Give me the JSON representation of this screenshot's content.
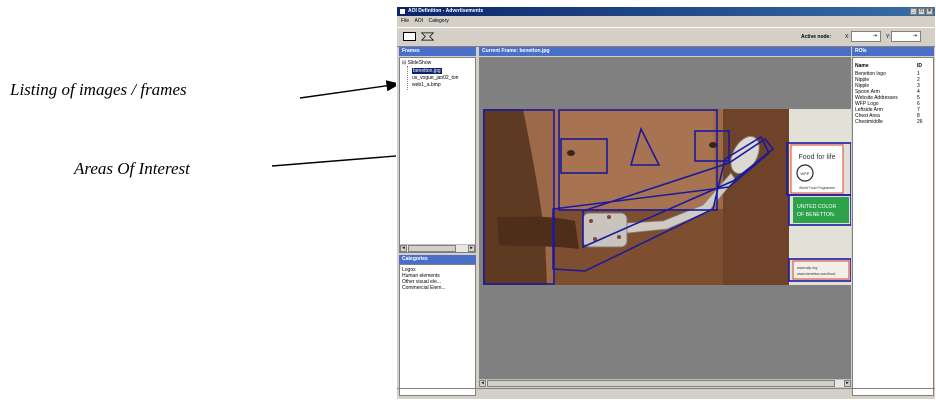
{
  "annotations": {
    "frames_listing": "Listing of images / frames",
    "areas_of_interest": "Areas Of Interest"
  },
  "window": {
    "title": "AOI Definition - Advertisements",
    "controls": [
      "_",
      "□",
      "×"
    ]
  },
  "menu": [
    "File",
    "AOI",
    "Category"
  ],
  "toolbar": {
    "rectangle_tool_icon": "rectangle-icon",
    "polygon_tool_icon": "polygon-icon",
    "active_node_label": "Active node:",
    "x_label": "X:",
    "y_label": "Y:",
    "x_value": "",
    "y_value": ""
  },
  "frames": {
    "header": "Frames",
    "root": "SlideShow",
    "items": [
      "benetton.jpg",
      "us_vogue_jan02_ton",
      "web1_a.bmp"
    ],
    "selected": "benetton.jpg"
  },
  "categories": {
    "header": "Categories",
    "items": [
      "Logos",
      "Human elements",
      "Other visual ele...",
      "Commercial Elem..."
    ]
  },
  "current_frame": {
    "header": "Current Frame: benetton.jpg",
    "ad_text": {
      "food": "Food for life",
      "wfp": "WFP",
      "wfp_sub": "World Food Programme",
      "ucb1": "UNITED COLOR",
      "ucb2": "OF BENETTON.",
      "url1": "www.wfp.org",
      "url2": "www.benetton.com/food"
    }
  },
  "rois": {
    "header": "ROIs",
    "columns": [
      "Name",
      "ID"
    ],
    "rows": [
      {
        "name": "Benetton logo",
        "id": "1"
      },
      {
        "name": "Nipple",
        "id": "2"
      },
      {
        "name": "Nipple",
        "id": "3"
      },
      {
        "name": "Spoon Arm",
        "id": "4"
      },
      {
        "name": "Website Addresses",
        "id": "5"
      },
      {
        "name": "WFP Logo",
        "id": "6"
      },
      {
        "name": "Leftside Arm",
        "id": "7"
      },
      {
        "name": "Chest Area",
        "id": "8"
      },
      {
        "name": "Chestmiddle",
        "id": "26"
      }
    ]
  }
}
